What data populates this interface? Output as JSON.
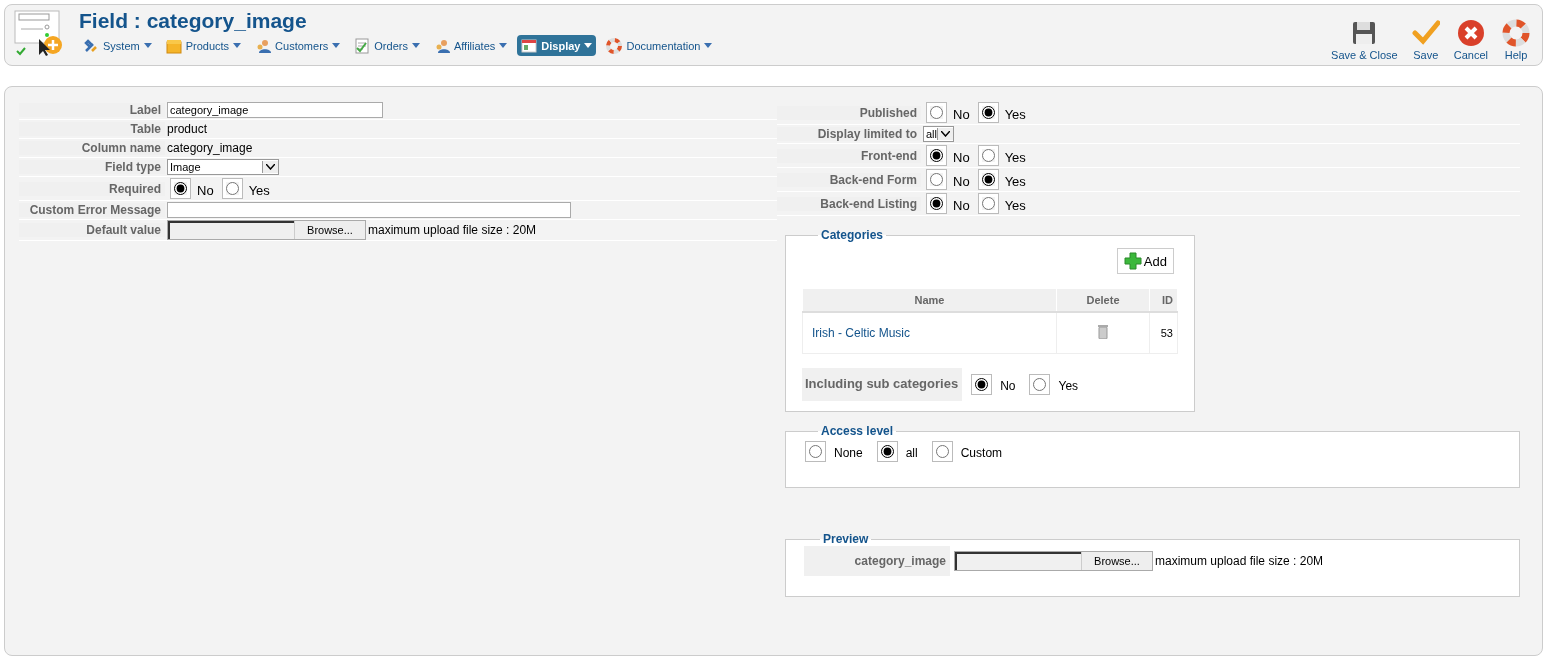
{
  "header": {
    "title": "Field : category_image",
    "menu": [
      {
        "label": "System",
        "selected": false
      },
      {
        "label": "Products",
        "selected": false
      },
      {
        "label": "Customers",
        "selected": false
      },
      {
        "label": "Orders",
        "selected": false
      },
      {
        "label": "Affiliates",
        "selected": false
      },
      {
        "label": "Display",
        "selected": true
      },
      {
        "label": "Documentation",
        "selected": false
      }
    ],
    "toolbar": [
      {
        "label": "Save & Close"
      },
      {
        "label": "Save"
      },
      {
        "label": "Cancel"
      },
      {
        "label": "Help"
      }
    ]
  },
  "left_form": [
    {
      "kind": "input",
      "label": "Label",
      "value": "category_image"
    },
    {
      "kind": "text",
      "label": "Table",
      "value": "product"
    },
    {
      "kind": "text",
      "label": "Column name",
      "value": "category_image"
    },
    {
      "kind": "select",
      "label": "Field type",
      "value": "Image"
    },
    {
      "kind": "radio",
      "label": "Required",
      "options": [
        {
          "label": "No",
          "selected": true
        },
        {
          "label": "Yes",
          "selected": false
        }
      ]
    },
    {
      "kind": "long_input",
      "label": "Custom Error Message"
    },
    {
      "kind": "file",
      "label": "Default value",
      "button": "Browse...",
      "note": "maximum upload file size : 20M"
    }
  ],
  "right_form": [
    {
      "kind": "radio",
      "label": "Published",
      "options": [
        {
          "label": "No",
          "selected": false
        },
        {
          "label": "Yes",
          "selected": true
        }
      ]
    },
    {
      "kind": "select",
      "label": "Display limited to",
      "value": "all"
    },
    {
      "kind": "radio",
      "label": "Front-end",
      "options": [
        {
          "label": "No",
          "selected": true
        },
        {
          "label": "Yes",
          "selected": false
        }
      ]
    },
    {
      "kind": "radio",
      "label": "Back-end Form",
      "options": [
        {
          "label": "No",
          "selected": false
        },
        {
          "label": "Yes",
          "selected": true
        }
      ]
    },
    {
      "kind": "radio",
      "label": "Back-end Listing",
      "options": [
        {
          "label": "No",
          "selected": true
        },
        {
          "label": "Yes",
          "selected": false
        }
      ]
    }
  ],
  "categories": {
    "legend": "Categories",
    "add_button": "Add",
    "columns": [
      "Name",
      "Delete",
      "ID"
    ],
    "rows": [
      {
        "name": "Irish - Celtic Music",
        "id": "53"
      }
    ],
    "sub_label": "Including sub categories",
    "sub_options": [
      {
        "label": "No",
        "selected": true
      },
      {
        "label": "Yes",
        "selected": false
      }
    ]
  },
  "access_level": {
    "legend": "Access level",
    "options": [
      {
        "label": "None",
        "selected": false
      },
      {
        "label": "all",
        "selected": true
      },
      {
        "label": "Custom",
        "selected": false
      }
    ]
  },
  "preview": {
    "legend": "Preview",
    "label": "category_image",
    "button": "Browse...",
    "note": "maximum upload file size : 20M"
  }
}
